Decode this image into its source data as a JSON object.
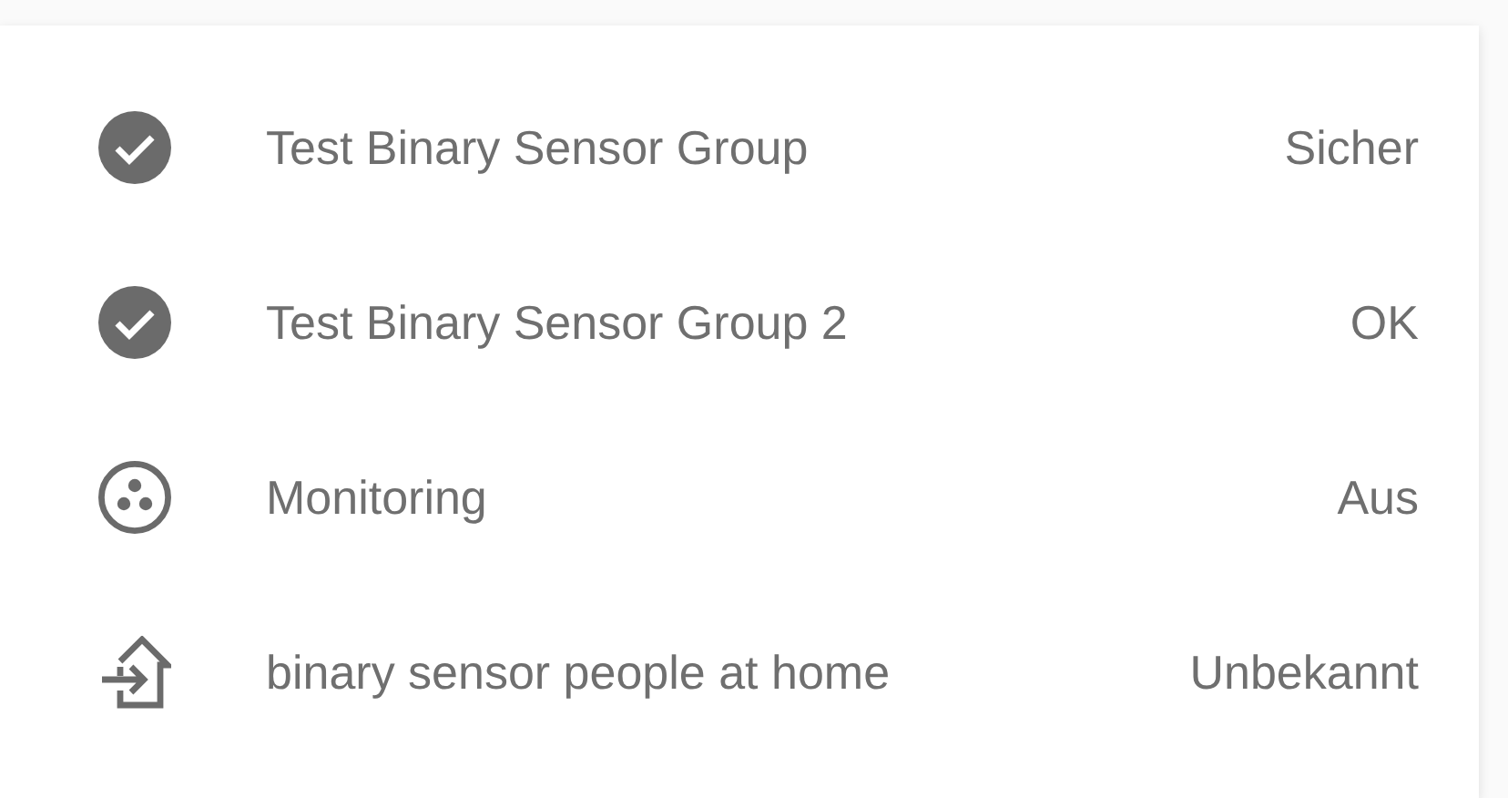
{
  "entities": [
    {
      "kind": "check",
      "name": "Test Binary Sensor Group",
      "state": "Sicher"
    },
    {
      "kind": "check",
      "name": "Test Binary Sensor Group 2",
      "state": "OK"
    },
    {
      "kind": "dots",
      "name": "Monitoring",
      "state": "Aus"
    },
    {
      "kind": "home",
      "name": "binary sensor people at home",
      "state": "Unbekannt"
    }
  ]
}
